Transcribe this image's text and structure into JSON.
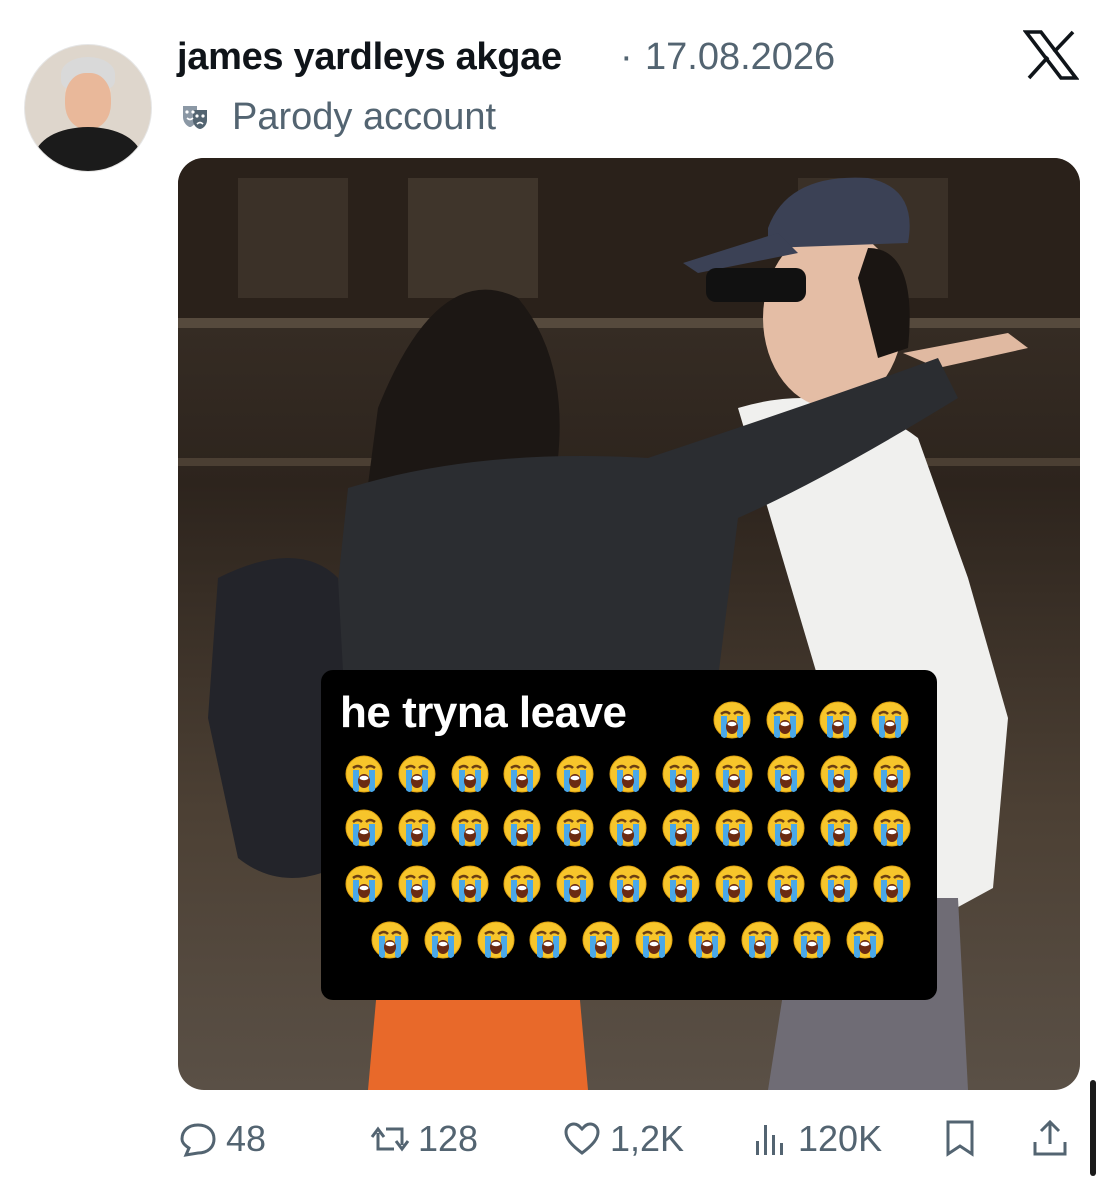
{
  "tweet": {
    "author_name": "james yardleys akgae",
    "separator": "·",
    "date": "17.08.2026",
    "badge_label": "Parody account",
    "badge_icon": "theater-mask-icon",
    "platform_icon": "x-logo-icon"
  },
  "media": {
    "caption": "he tryna leave",
    "caption_emoji": "loudly-crying-face-icon",
    "emoji_rows": [
      4,
      11,
      11,
      11,
      10
    ]
  },
  "actions": {
    "replies": "48",
    "reposts": "128",
    "likes": "1,2K",
    "views": "120K"
  },
  "colors": {
    "text_primary": "#0f1419",
    "text_secondary": "#536471",
    "caption_bg": "#000000"
  }
}
